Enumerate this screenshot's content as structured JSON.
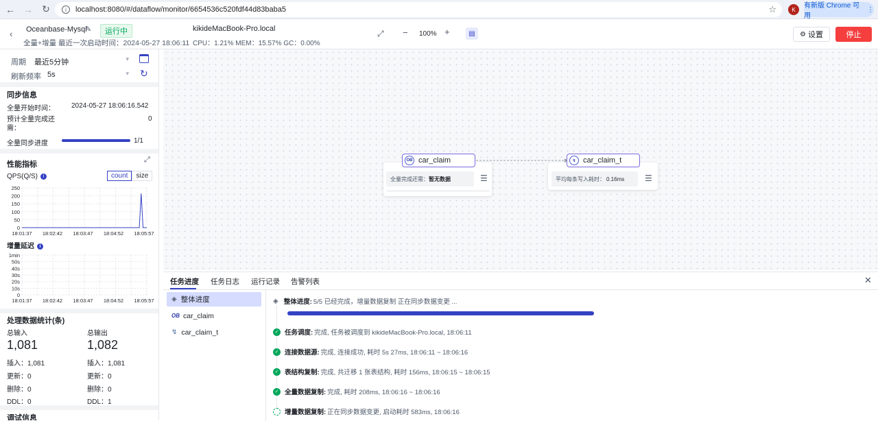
{
  "browser": {
    "url": "localhost:8080/#/dataflow/monitor/6654536c520fdf44d83baba5",
    "profile_initial": "K",
    "update_label": "有新版 Chrome 可用"
  },
  "header": {
    "task_name": "Oceanbase-Mysql",
    "status": "运行中",
    "subtitle": "全量+增量  最近一次启动时间：2024-05-27 18:06:11",
    "host": "kikideMacBook-Pro.local",
    "metrics": "CPU：1.21%   MEM：15.57%   GC：0.00%",
    "zoom": "100%",
    "settings_label": "设置",
    "stop_label": "停止"
  },
  "sidebar": {
    "period_label": "周期",
    "period_value": "最近5分钟",
    "refresh_label": "刷新频率",
    "refresh_value": "5s",
    "sync_title": "同步信息",
    "full_start_label": "全量开始时间：",
    "full_start_value": "2024-05-27 18:06:16.542",
    "eta_label": "预计全量完成还需：",
    "eta_value": "0",
    "progress_label": "全量同步进度",
    "progress_value": "1/1",
    "progress_fraction": 1.0,
    "perf_title": "性能指标",
    "qps_label": "QPS(Q/S)",
    "seg_count": "count",
    "seg_size": "size",
    "latency_label": "增量延迟",
    "stats_title": "处理数据统计(条)",
    "in_label": "总输入",
    "in_value": "1,081",
    "out_label": "总输出",
    "out_value": "1,082",
    "in_insert": "插入：1,081",
    "in_update": "更新：0",
    "in_delete": "删除：0",
    "in_ddl": "DDL：0",
    "out_insert": "插入：1,081",
    "out_update": "更新：0",
    "out_delete": "删除：0",
    "out_ddl": "DDL：1",
    "debug_title": "调试信息"
  },
  "chart_data": [
    {
      "type": "line",
      "title": "QPS(Q/S)",
      "x": [
        "18:01:37",
        "18:02:42",
        "18:03:47",
        "18:04:52",
        "18:05:57"
      ],
      "y_ticks": [
        "250",
        "200",
        "150",
        "100",
        "50",
        "0"
      ],
      "ylim": [
        0,
        250
      ],
      "series": [
        {
          "values_at_fraction": [
            [
              0.0,
              0
            ],
            [
              0.94,
              0
            ],
            [
              0.955,
              215
            ],
            [
              0.97,
              0
            ],
            [
              1.0,
              0
            ]
          ]
        }
      ],
      "grid": true
    },
    {
      "type": "line",
      "title": "增量延迟",
      "x": [
        "18:01:37",
        "18:02:42",
        "18:03:47",
        "18:04:52",
        "18:05:57"
      ],
      "y_ticks": [
        "1min",
        "50s",
        "40s",
        "30s",
        "20s",
        "10s",
        "0"
      ],
      "grid": true
    }
  ],
  "canvas": {
    "source_node": {
      "name": "car_claim",
      "metric_label": "全量完成还需：",
      "metric_value": "暂无数据",
      "icon": "oceanbase-icon"
    },
    "target_node": {
      "name": "car_claim_t",
      "metric_label": "平均每条写入耗时：",
      "metric_value": "0.16ms",
      "icon": "mysql-icon"
    }
  },
  "bottom": {
    "tabs": [
      "任务进度",
      "任务日志",
      "运行记录",
      "告警列表"
    ],
    "list": [
      "整体进度",
      "car_claim",
      "car_claim_t"
    ],
    "overall_label": "整体进度:",
    "overall_text": "5/5 已经完成，增量数据复制 正在同步数据变更 ...",
    "overall_fraction": 1.0,
    "steps": [
      {
        "label": "任务调度:",
        "text": "完成, 任务被调度到 kikideMacBook-Pro.local, 18:06:11"
      },
      {
        "label": "连接数据源:",
        "text": "完成, 连接成功, 耗时 5s 27ms, 18:06:11 ~ 18:06:16"
      },
      {
        "label": "表结构复制:",
        "text": "完成, 共迁移 1 张表结构, 耗时 156ms, 18:06:15 ~ 18:06:15"
      },
      {
        "label": "全量数据复制:",
        "text": "完成, 耗时 208ms, 18:06:16 ~ 18:06:16"
      },
      {
        "label": "增量数据复制:",
        "text": "正在同步数据变更, 启动耗时 583ms, 18:06:16"
      }
    ]
  }
}
